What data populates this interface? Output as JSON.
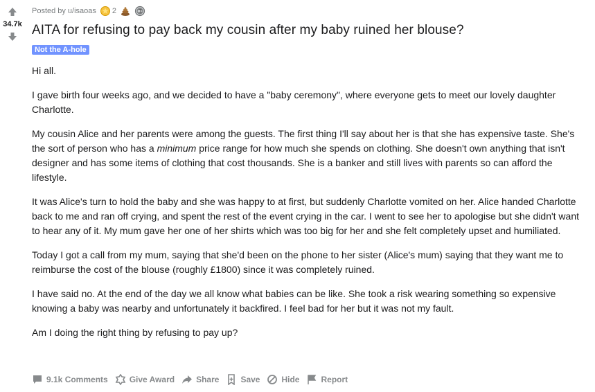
{
  "vote": {
    "count": "34.7k"
  },
  "meta": {
    "posted_by": "Posted by",
    "username": "u/isaoas",
    "awards": [
      {
        "icon": "gold-award-icon",
        "count": "2",
        "color": "#f6c23e"
      },
      {
        "icon": "poop-award-icon",
        "count": "",
        "color": "#8b5a2b"
      },
      {
        "icon": "silver-award-icon",
        "count": "",
        "color": "#9ea1a3"
      }
    ]
  },
  "post": {
    "title": "AITA for refusing to pay back my cousin after my baby ruined her blouse?",
    "flair": "Not the A-hole",
    "flair_color": "#7193ff",
    "paragraphs": {
      "p1": "Hi all.",
      "p2": "I gave birth four weeks ago, and we decided to have a \"baby ceremony\", where everyone gets to meet our lovely daughter Charlotte.",
      "p3_a": "My cousin Alice and her parents were among the guests. The first thing I'll say about her is that she has expensive taste. She's the sort of person who has a ",
      "p3_em": "minimum",
      "p3_b": " price range for how much she spends on clothing. She doesn't own anything that isn't designer and has some items of clothing that cost thousands. She is a banker and still lives with parents so can afford the lifestyle.",
      "p4": "It was Alice's turn to hold the baby and she was happy to at first, but suddenly Charlotte vomited on her. Alice handed Charlotte back to me and ran off crying, and spent the rest of the event crying in the car. I went to see her to apologise but she didn't want to hear any of it. My mum gave her one of her shirts which was too big for her and she felt completely upset and humiliated.",
      "p5": "Today I got a call from my mum, saying that she'd been on the phone to her sister (Alice's mum) saying that they want me to reimburse the cost of the blouse (roughly £1800) since it was completely ruined.",
      "p6": "I have said no. At the end of the day we all know what babies can be like. She took a risk wearing something so expensive knowing a baby was nearby and unfortunately it backfired. I feel bad for her but it was not my fault.",
      "p7": "Am I doing the right thing by refusing to pay up?"
    }
  },
  "actions": {
    "comments": "9.1k Comments",
    "give_award": "Give Award",
    "share": "Share",
    "save": "Save",
    "hide": "Hide",
    "report": "Report"
  }
}
